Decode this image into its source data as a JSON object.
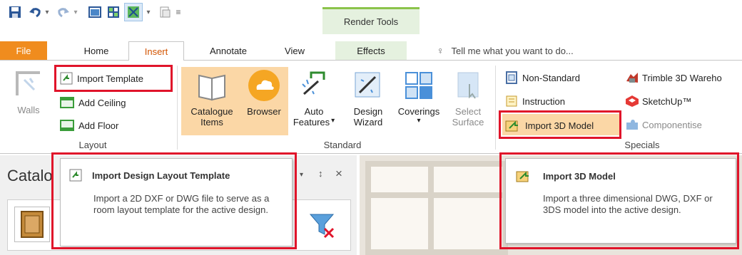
{
  "context_tab": {
    "label": "Render Tools"
  },
  "tabs": [
    {
      "label": "File"
    },
    {
      "label": "Home"
    },
    {
      "label": "Insert"
    },
    {
      "label": "Annotate"
    },
    {
      "label": "View"
    },
    {
      "label": "Effects"
    }
  ],
  "tell_me": {
    "placeholder": "Tell me what you want to do..."
  },
  "layout_group": {
    "label": "Layout",
    "walls": "Walls",
    "import_template": "Import Template",
    "add_ceiling": "Add Ceiling",
    "add_floor": "Add Floor"
  },
  "standard_group": {
    "label": "Standard",
    "catalogue_items_line1": "Catalogue",
    "catalogue_items_line2": "Items",
    "browser": "Browser",
    "auto_features_line1": "Auto",
    "auto_features_line2": "Features",
    "design_wizard_line1": "Design",
    "design_wizard_line2": "Wizard",
    "coverings": "Coverings",
    "select_surface_line1": "Select",
    "select_surface_line2": "Surface"
  },
  "specials_group": {
    "label": "Specials",
    "non_standard": "Non-Standard",
    "instruction": "Instruction",
    "import_3d_model": "Import 3D Model",
    "trimble": "Trimble 3D Wareho",
    "sketchup": "SketchUp™",
    "componentise": "Componentise"
  },
  "panel": {
    "title": "Catalo",
    "pin": "↕",
    "close": "×"
  },
  "tooltip_template": {
    "title": "Import Design Layout Template",
    "body": "Import a 2D DXF or DWG file to serve as a room layout template for the active design."
  },
  "tooltip_model": {
    "title": "Import 3D Model",
    "body": "Import a three dimensional DWG, DXF or 3DS model into the active design."
  },
  "colors": {
    "accent": "#f08c1e",
    "highlight": "#fbd7a6",
    "annotation": "#e0142a",
    "context": "#e5f1df"
  }
}
